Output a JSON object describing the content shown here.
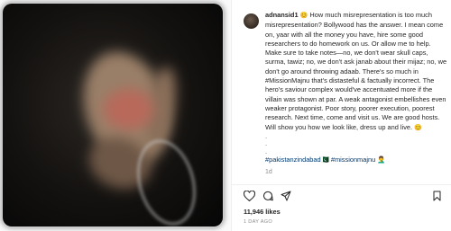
{
  "post": {
    "username": "adnansid1",
    "caption_text": "How much misrepresentation is too much misrepresentation? Bollywood has the answer. I mean come on, yaar with all the money you have, hire some good researchers to do homework on us. Or allow me to help. Make sure to take notes—no, we don't wear skull caps, surma, tawiz; no, we don't ask janab about their mijaz; no, we don't go around throwing adaab. There's so much in #MissionMajnu that's distasteful & factually incorrect. The hero's saviour complex would've accentuated more if the villain was shown at par. A weak antagonist embellishes even weaker protagonist. Poor story, poorer execution, poorest research. Next time, come and visit us. We are good hosts. Will show you how we look like, dress up and live.",
    "caption_emoji": "😊",
    "dots": [
      ".",
      ".",
      "."
    ],
    "hashtags": "#pakistanzindabad🇵🇰 #missionmajnu",
    "hashtags_emoji": "🤦‍♂️",
    "time_ago": "1d",
    "likes": "11,946 likes",
    "posted_date": "1 DAY AGO"
  },
  "icons": {
    "avatar": "user-avatar",
    "like": "heart-icon",
    "comment": "comment-icon",
    "share": "share-icon",
    "save": "bookmark-icon"
  },
  "colors": {
    "text": "#262626",
    "muted": "#8e8e8e",
    "hashtag": "#00376b",
    "divider": "#efefef"
  }
}
